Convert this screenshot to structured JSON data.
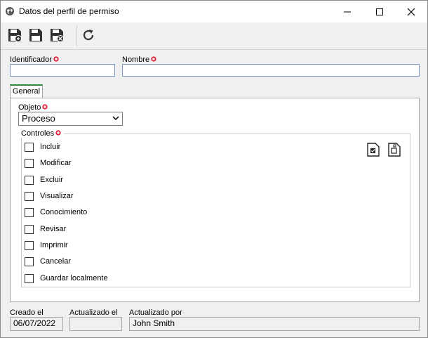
{
  "window": {
    "title": "Datos del perfil de permiso"
  },
  "toolbar": {
    "buttons": [
      {
        "name": "save-new-button",
        "icon": "save-new-icon"
      },
      {
        "name": "save-button",
        "icon": "save-icon"
      },
      {
        "name": "save-close-button",
        "icon": "save-close-icon"
      },
      {
        "name": "refresh-button",
        "icon": "refresh-icon"
      }
    ]
  },
  "form": {
    "identifier": {
      "label": "Identificador",
      "value": ""
    },
    "name": {
      "label": "Nombre",
      "value": ""
    }
  },
  "tabs": [
    {
      "label": "General",
      "active": true
    }
  ],
  "general": {
    "object": {
      "label": "Objeto",
      "value": "Proceso"
    },
    "controls": {
      "label": "Controles",
      "items": [
        {
          "label": "Incluir",
          "checked": false
        },
        {
          "label": "Modificar",
          "checked": false
        },
        {
          "label": "Excluir",
          "checked": false
        },
        {
          "label": "Visualizar",
          "checked": false
        },
        {
          "label": "Conocimiento",
          "checked": false
        },
        {
          "label": "Revisar",
          "checked": false
        },
        {
          "label": "Imprimir",
          "checked": false
        },
        {
          "label": "Cancelar",
          "checked": false
        },
        {
          "label": "Guardar localmente",
          "checked": false
        }
      ]
    }
  },
  "footer": {
    "created": {
      "label": "Creado el",
      "value": "06/07/2022"
    },
    "updated": {
      "label": "Actualizado el",
      "value": ""
    },
    "updated_by": {
      "label": "Actualizado por",
      "value": "John Smith"
    }
  },
  "colors": {
    "required": "#e0001b",
    "tab_accent": "#2e8b3d",
    "input_border": "#7a9cc6"
  }
}
